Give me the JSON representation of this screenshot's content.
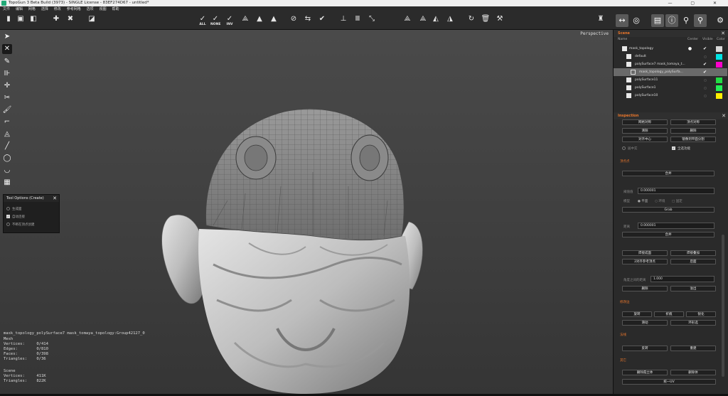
{
  "window": {
    "title": "TopoGun 3 Beta Build (3973) - SINGLE License - 83EF274D67 - untitled*",
    "controls": "— ▢ ✕"
  },
  "menu": [
    "文件",
    "编辑",
    "网格",
    "选择",
    "修改",
    "参考网格",
    "选项",
    "视图",
    "帮助"
  ],
  "toolbar": {
    "select_all": "ALL",
    "select_none": "NONE",
    "select_inv": "INV"
  },
  "viewport": {
    "camera": "Perspective"
  },
  "tool_options": {
    "title": "Tool Options (Create)",
    "options": [
      {
        "label": "生成面",
        "checked": false
      },
      {
        "label": "自动连接",
        "checked": true
      },
      {
        "label": "不断在顶点创建",
        "checked": false
      }
    ]
  },
  "info": {
    "object": "mask_topology_polySurface7 mask_tomaya_topology:Group42127_0",
    "mesh": "Mesh\nVertices:     0/414\nEdges:        0/810\nFaces:        0/398\nTriangles:    0/36",
    "scene": "Scene\nVertices:     411K\nTriangles:    822K"
  },
  "scene": {
    "title": "Scene",
    "columns": {
      "name": "Name",
      "center": "Center",
      "visible": "Visible",
      "color": "Color"
    },
    "rows": [
      {
        "label": "mask_topology",
        "visible": true,
        "color": "#d8d8d8",
        "indent": 0
      },
      {
        "label": "default",
        "visible": false,
        "color": "#00e5e5",
        "indent": 1
      },
      {
        "label": "polySurface7 mask_tomaya_t...",
        "visible": true,
        "color": "#ff00cc",
        "indent": 1
      },
      {
        "label": "mask_topology_polySurfa...",
        "visible": true,
        "color": "",
        "indent": 2,
        "selected": true
      },
      {
        "label": "polySurface11",
        "visible": false,
        "color": "#22dd44",
        "indent": 1
      },
      {
        "label": "polySurface1",
        "visible": false,
        "color": "#22ee55",
        "indent": 1
      },
      {
        "label": "polySurface10",
        "visible": false,
        "color": "#ffee00",
        "indent": 1
      }
    ]
  },
  "inspection": {
    "title": "Inspection",
    "top_buttons": [
      "网格对称",
      "顶点对称",
      "清除",
      "删除",
      "对齐中心",
      "镜像到平面分割"
    ],
    "check_options": [
      {
        "label": "居中实",
        "checked": false
      },
      {
        "label": "全选功能",
        "checked": true
      }
    ],
    "section_point": "顶点点",
    "btn_merge_top": "合并",
    "threshold_label": "阈值值",
    "threshold_value": "0.000001",
    "mode_label": "模型",
    "mode_options": [
      "平面",
      "环境",
      "固定"
    ],
    "btn_grab": "Grab",
    "distance_label": "距离",
    "distance_value": "0.000001",
    "btn_merge": "合并",
    "buttons_mid": [
      "焊接成面",
      "焊接叠加",
      "2对齐参考顶点",
      "后面"
    ],
    "angle_label": "角度之间的距离",
    "angle_value": "1.000",
    "buttons_mid2": [
      "删除",
      "溢出"
    ],
    "section_edit": "修改边",
    "buttons_edit": [
      "旋转",
      "折痕",
      "锐化",
      "滑动",
      "环形选"
    ],
    "section_uv": "法线",
    "buttons_uv": [
      "反转",
      "重建"
    ],
    "section_other": "其它",
    "buttons_other": [
      "删除孤立体",
      "删除体",
      "统一UV"
    ]
  },
  "colors": {
    "accent": "#e9762b"
  }
}
